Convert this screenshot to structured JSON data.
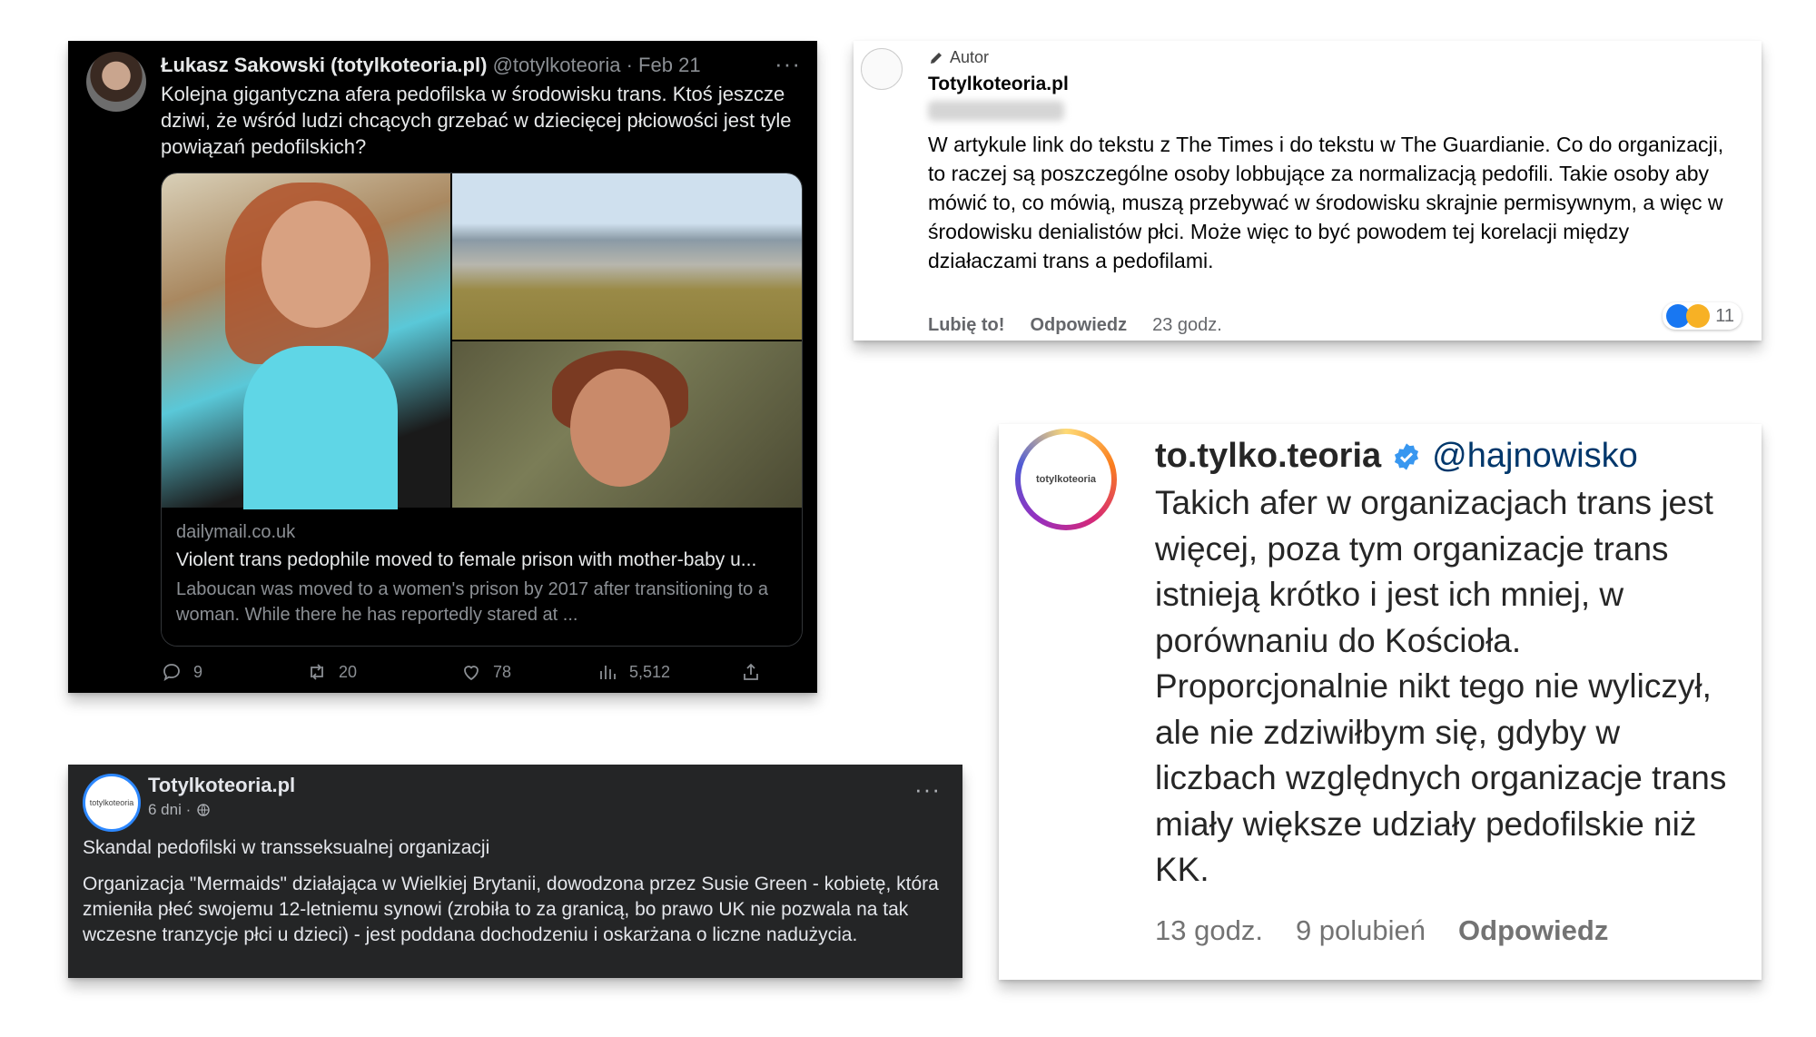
{
  "tweet": {
    "name": "Łukasz Sakowski (totylkoteoria.pl)",
    "handle_date": "@totylkoteoria · Feb 21",
    "more": "···",
    "text": "Kolejna gigantyczna afera pedofilska w środowisku trans. Ktoś jeszcze dziwi, że wśród ludzi chcących grzebać w dziecięcej płciowości jest tyle powiązań pedofilskich?",
    "link": {
      "domain": "dailymail.co.uk",
      "title": "Violent trans pedophile moved to female prison with mother-baby u...",
      "description": "Laboucan was moved to a women's prison by 2017 after transitioning to a woman. While there he has reportedly stared at ..."
    },
    "actions": {
      "replies": "9",
      "retweets": "20",
      "likes": "78",
      "views": "5,512"
    }
  },
  "comment_fb": {
    "badge": "Autor",
    "name": "Totylkoteoria.pl",
    "text": "W artykule link do tekstu z The Times i do tekstu w The Guardianie. Co do organizacji, to raczej są poszczególne osoby lobbujące za normalizacją pedofili. Takie osoby aby mówić to, co mówią, muszą przebywać w środowisku skrajnie permisywnym, a więc w środowisku denialistów płci. Może więc to być powodem tej korelacji między działaczami trans a pedofilami.",
    "like": "Lubię to!",
    "reply": "Odpowiedz",
    "time": "23 godz.",
    "reaction_count": "11",
    "colors": {
      "like": "#1877f2",
      "haha": "#f7b125"
    }
  },
  "instagram": {
    "avatar_label": "totylkoteoria",
    "username": "to.tylko.teoria",
    "mention": "@hajnowisko",
    "text": "Takich afer w organizacjach trans jest więcej, poza tym organizacje trans istnieją krótko i jest ich mniej, w porównaniu do Kościoła. Proporcjonalnie nikt tego nie wyliczył, ale nie zdziwiłbym się, gdyby w liczbach względnych organizacje trans miały większe udziały pedofilskie niż KK.",
    "time": "13 godz.",
    "likes": "9 polubień",
    "reply": "Odpowiedz"
  },
  "fb_post": {
    "avatar_label": "totylkoteoria",
    "name": "Totylkoteoria.pl",
    "time": "6 dni ·",
    "more": "···",
    "title": "Skandal pedofilski w transseksualnej organizacji",
    "text": "Organizacja \"Mermaids\" działająca w Wielkiej Brytanii, dowodzona przez Susie Green - kobietę, która zmieniła płeć swojemu 12-letniemu synowi (zrobiła to za granicą, bo prawo UK nie pozwala na tak wczesne tranzycje płci u dzieci) - jest poddana dochodzeniu i oskarżana o liczne nadużycia."
  }
}
